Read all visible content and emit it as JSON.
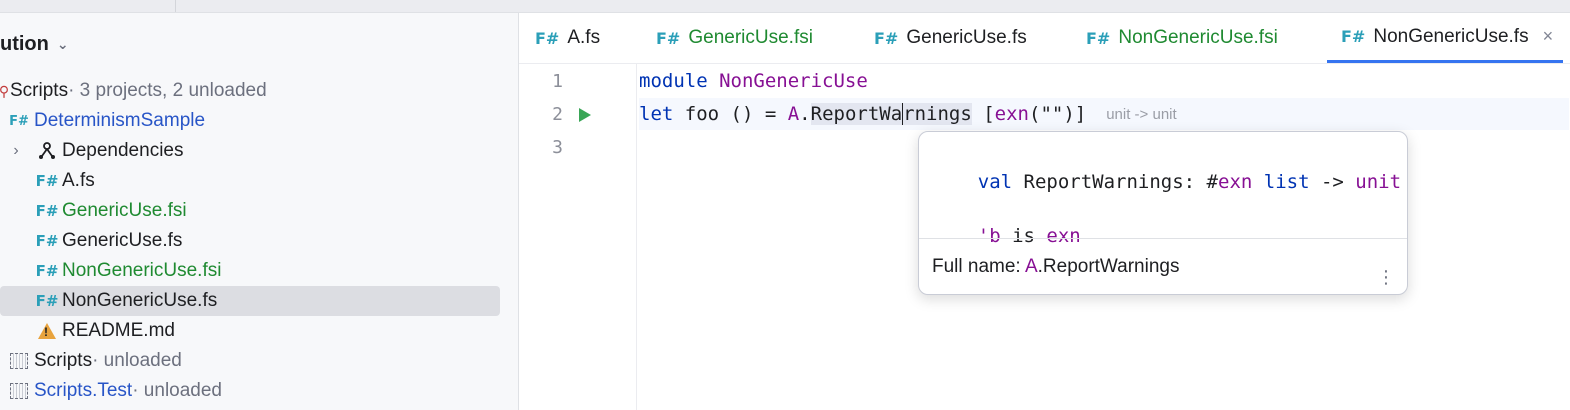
{
  "sidebar": {
    "title": "ution",
    "title_chevron": "⌄",
    "tree": [
      {
        "label": "Scripts",
        "suffix": " · 3 projects, 2 unloaded",
        "icon": "solution-icon"
      },
      {
        "label": "DeterminismSample",
        "icon": "fsharp-project-icon"
      },
      {
        "label": "Dependencies",
        "icon": "dependencies-icon",
        "expander": "›"
      },
      {
        "label": "A.fs",
        "icon": "fsharp-file-icon"
      },
      {
        "label": "GenericUse.fsi",
        "icon": "fsharp-file-icon"
      },
      {
        "label": "GenericUse.fs",
        "icon": "fsharp-file-icon"
      },
      {
        "label": "NonGenericUse.fsi",
        "icon": "fsharp-file-icon"
      },
      {
        "label": "NonGenericUse.fs",
        "icon": "fsharp-file-icon"
      },
      {
        "label": "README.md",
        "icon": "warning-icon"
      },
      {
        "label": "Scripts",
        "suffix": " · unloaded",
        "icon": "unloaded-project-icon"
      },
      {
        "label": "Scripts.Test",
        "suffix": " · unloaded",
        "icon": "unloaded-project-icon"
      }
    ],
    "fsharp_glyph": "F#"
  },
  "tabs": [
    {
      "label": "A.fs"
    },
    {
      "label": "GenericUse.fsi"
    },
    {
      "label": "GenericUse.fs"
    },
    {
      "label": "NonGenericUse.fsi"
    },
    {
      "label": "NonGenericUse.fs",
      "close": "×"
    }
  ],
  "editor": {
    "line_numbers": [
      "1",
      "2",
      "3"
    ],
    "line1": {
      "kw": "module",
      "name": "NonGenericUse"
    },
    "line2": {
      "kw": "let",
      "t1": " foo () = ",
      "mod": "A",
      "dot": ".",
      "fn_a": "ReportWa",
      "fn_b": "rnings",
      "t2": " [",
      "exn": "exn",
      "t3": "(\"\")]",
      "hint": "unit -> unit"
    }
  },
  "popup": {
    "sig_kw": "val",
    "sig_name": " ReportWarnings: #",
    "sig_exn": "exn",
    "sig_list": " list",
    "sig_arrow": " -> ",
    "sig_unit": "unit",
    "gen_tick": "'b",
    "gen_is": " is ",
    "gen_exn": "exn",
    "full_label": "Full name: ",
    "full_mod": "A",
    "full_rest": ".ReportWarnings",
    "more": "⋮"
  },
  "colors": {
    "keyword": "#0033b3",
    "type": "#871094",
    "fsharp_icon": "#2b9fb8",
    "vcs_added": "#1f8a31",
    "link_blue": "#2855c7",
    "active_tab_underline": "#3574f0"
  }
}
